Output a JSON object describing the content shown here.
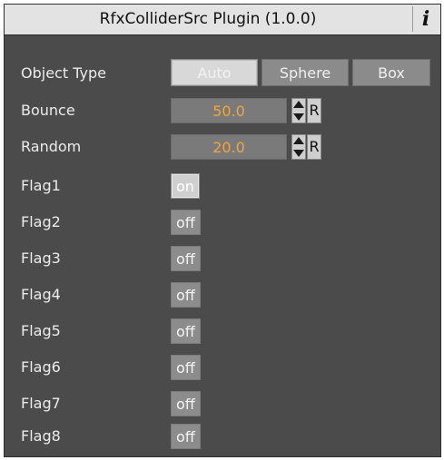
{
  "header": {
    "title": "RfxColliderSrc Plugin (1.0.0)",
    "info_glyph": "i"
  },
  "object_type": {
    "label": "Object Type",
    "options": [
      "Auto",
      "Sphere",
      "Box"
    ],
    "selected": "Auto"
  },
  "bounce": {
    "label": "Bounce",
    "value": "50.0",
    "reset": "R"
  },
  "random": {
    "label": "Random",
    "value": "20.0",
    "reset": "R"
  },
  "flags": [
    {
      "label": "Flag1",
      "state": "on"
    },
    {
      "label": "Flag2",
      "state": "off"
    },
    {
      "label": "Flag3",
      "state": "off"
    },
    {
      "label": "Flag4",
      "state": "off"
    },
    {
      "label": "Flag5",
      "state": "off"
    },
    {
      "label": "Flag6",
      "state": "off"
    },
    {
      "label": "Flag7",
      "state": "off"
    },
    {
      "label": "Flag8",
      "state": "off"
    }
  ],
  "colors": {
    "panel_bg": "#4b4b4b",
    "value_text": "#f0a63a",
    "header_bg": "#e3e3e3"
  }
}
